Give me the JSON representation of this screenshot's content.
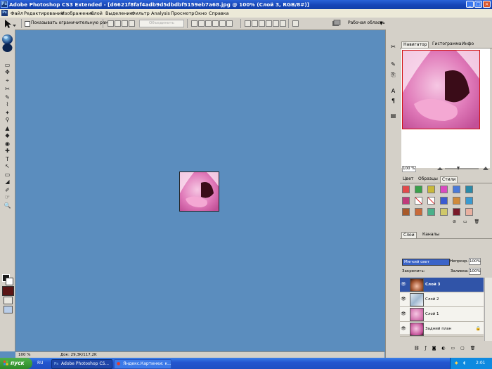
{
  "window": {
    "app_badge": "Ps",
    "title": "Adobe Photoshop CS3 Extended - [d6621f8faf4adb9d5dbdbf5159eb7a68.jpg @ 100% (Слой 3, RGB/8#)]",
    "controls": [
      "_",
      "□",
      "×"
    ]
  },
  "menu": {
    "app_badge": "Ps",
    "items": [
      "Файл",
      "Редактирование",
      "Изображение",
      "Слой",
      "Выделение",
      "Фильтр",
      "Analysis",
      "Просмотр",
      "Окно",
      "Справка"
    ]
  },
  "options_bar": {
    "checkbox_label": "Показывать ограничительную рамку",
    "disabled_field": "Объединить",
    "workspace_label": "Рабочая область",
    "workspace_arrow": "▼"
  },
  "tools": {
    "items": [
      "▭",
      "✥",
      "⌖",
      "✂",
      "✎",
      "⌇",
      "✦",
      "⚲",
      "▲",
      "◆",
      "◉",
      "✚",
      "T",
      "↖",
      "▭",
      "◢",
      "✐",
      "☞",
      "🔍"
    ]
  },
  "status_bar": {
    "zoom": "100 %",
    "doc_info": "Док: 29,3K/117,2K"
  },
  "navigator_panel": {
    "tabs": [
      "Навигатор",
      "Гистограмма",
      "Инфо"
    ],
    "zoom": "100 %"
  },
  "styles_panel": {
    "tabs": [
      "Цвет",
      "Образцы",
      "Стили"
    ]
  },
  "layers_panel": {
    "tabs": [
      "Слои",
      "Каналы"
    ],
    "blend_mode": "Мягкий свет",
    "opacity_label": "Непрозр.:",
    "opacity_value": "100%",
    "lock_label": "Закрепить:",
    "fill_label": "Заливка:",
    "fill_value": "100%",
    "layers": [
      {
        "name": "Слой 3",
        "selected": true
      },
      {
        "name": "Слой 2",
        "selected": false
      },
      {
        "name": "Слой 1",
        "selected": false
      },
      {
        "name": "Задний план",
        "selected": false
      }
    ]
  },
  "taskbar": {
    "start_label": "пуск",
    "language": "RU",
    "tasks": [
      {
        "label": "Adobe Photoshop CS..."
      },
      {
        "label": "Яндекс.Картинки: к..."
      }
    ],
    "clock": "2:01"
  },
  "colors": {
    "canvas_bg": "#5b8dbe",
    "panel_bg": "#d4d0c8",
    "title_blue": "#1646b8",
    "selection_blue": "#3054a8",
    "nav_frame": "#d21515"
  }
}
